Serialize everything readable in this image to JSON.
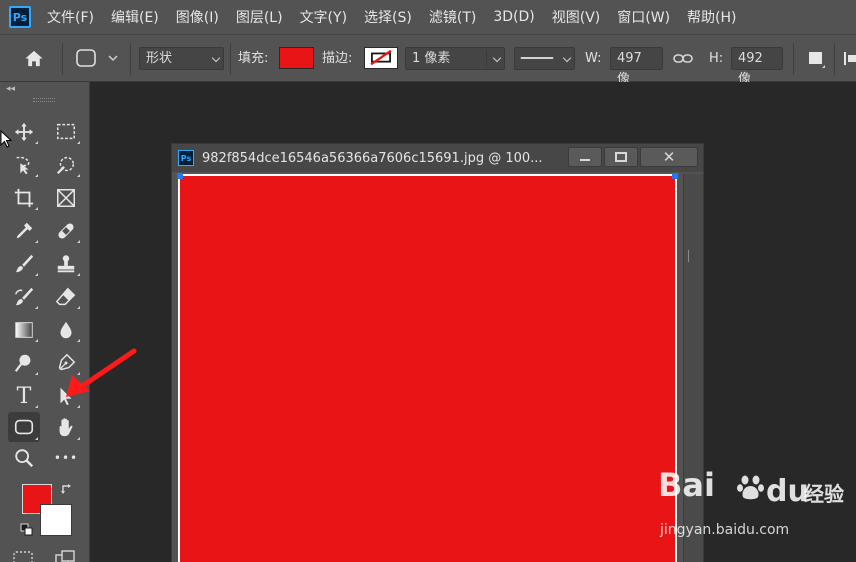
{
  "app": {
    "logo": "Ps",
    "menu": [
      "文件(F)",
      "编辑(E)",
      "图像(I)",
      "图层(L)",
      "文字(Y)",
      "选择(S)",
      "滤镜(T)",
      "3D(D)",
      "视图(V)",
      "窗口(W)",
      "帮助(H)"
    ]
  },
  "options": {
    "mode": "形状",
    "fill_label": "填充:",
    "fill_color": "#e81416",
    "stroke_label": "描边:",
    "stroke_width": "1 像素",
    "w_label": "W:",
    "w_value": "497 像",
    "h_label": "H:",
    "h_value": "492 像"
  },
  "tools": {
    "foreground_color": "#e81416",
    "background_color": "#ffffff",
    "active_tool": "rounded-rectangle-tool",
    "text_tool_glyph": "T",
    "more_glyph": "•••"
  },
  "document": {
    "title": "982f854dce16546a56366a7606c15691.jpg @ 100...",
    "shape_color": "#e81416",
    "win_close": "✕"
  },
  "watermark": {
    "main": "Bai",
    "du": "du",
    "cn": "经验",
    "url": "jingyan.baidu.com"
  },
  "annotation": {
    "arrow_color": "#ff1a1a"
  }
}
